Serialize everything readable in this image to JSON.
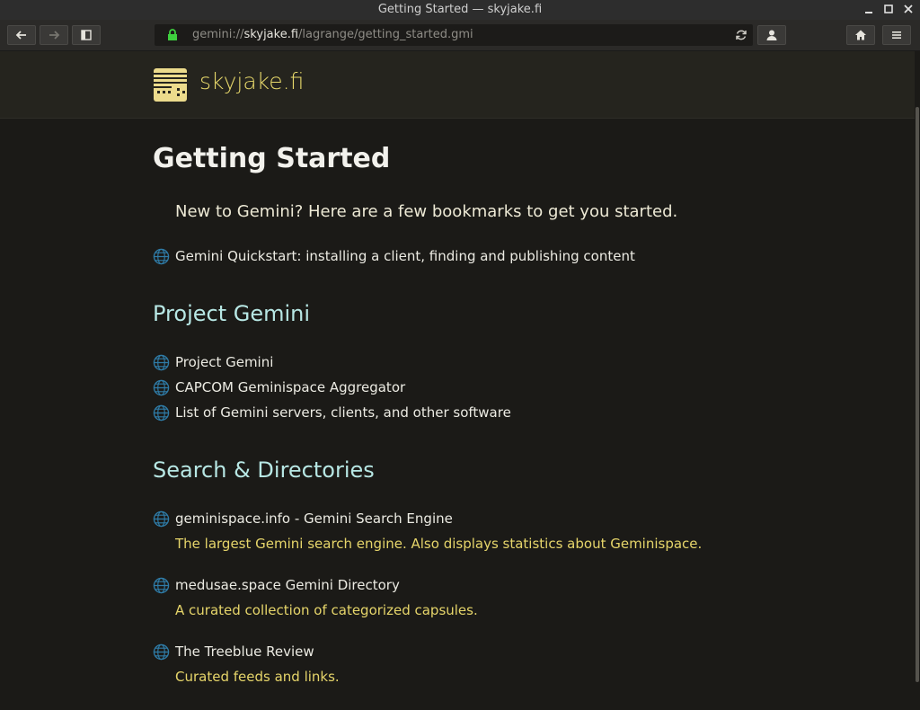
{
  "window": {
    "title": "Getting Started — skyjake.fi",
    "minimize": "▁",
    "maximize": "□",
    "close": "✕"
  },
  "toolbar": {
    "url_scheme": "gemini://",
    "url_host": "skyjake.fi",
    "url_path": "/lagrange/getting_started.gmi"
  },
  "banner": {
    "site_name": "skyjake.fi"
  },
  "page": {
    "heading": "Getting Started",
    "intro": "New to Gemini? Here are a few bookmarks to get you started.",
    "quickstart": "Gemini Quickstart: installing a client, finding and publishing content",
    "section1_title": "Project Gemini",
    "section1_links": [
      "Project Gemini",
      "CAPCOM Geminispace Aggregator",
      "List of Gemini servers, clients, and other software"
    ],
    "section2_title": "Search & Directories",
    "section2_items": [
      {
        "link": "geminispace.info - Gemini Search Engine",
        "desc": "The largest Gemini search engine. Also displays statistics about Geminispace."
      },
      {
        "link": "medusae.space Gemini Directory",
        "desc": "A curated collection of categorized capsules."
      },
      {
        "link": "The Treeblue Review",
        "desc": "Curated feeds and links."
      }
    ]
  },
  "colors": {
    "background": "#1b1a17",
    "banner": "#25241e",
    "accent_yellow": "#e6d76a",
    "heading_cyan": "#b7e7e4",
    "lock_green": "#3ecf3e"
  }
}
